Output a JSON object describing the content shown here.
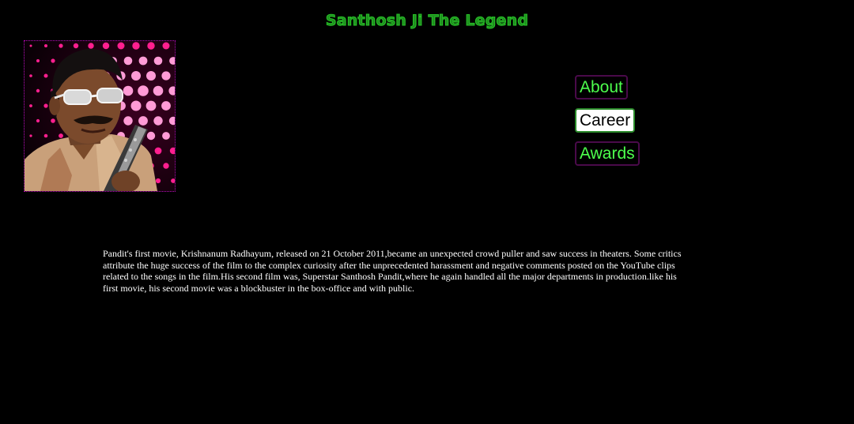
{
  "page": {
    "title": "Santhosh Ji The Legend"
  },
  "portrait": {
    "subject": "man-with-sunglasses-photo"
  },
  "nav": {
    "items": [
      {
        "label": "About",
        "active": false
      },
      {
        "label": "Career",
        "active": true
      },
      {
        "label": "Awards",
        "active": false
      }
    ]
  },
  "content": {
    "paragraph": "Pandit's first movie, Krishnanum Radhayum, released on 21 October 2011,became an unexpected crowd puller and saw success in theaters. Some critics attribute the huge success of the film to the complex curiosity after the unprecedented harassment and negative comments posted on the YouTube clips related to the songs in the film.His second film was, Superstar Santhosh Pandit,where he again handled all the major departments in production.like his first movie, his second movie was a blockbuster in the box-office and with public."
  },
  "colors": {
    "background": "#000000",
    "title": "#27c427",
    "nav_text": "#4dff4d",
    "nav_border": "#4a0a4a",
    "frame_border": "#b400b4",
    "body_text": "#ffffff"
  }
}
